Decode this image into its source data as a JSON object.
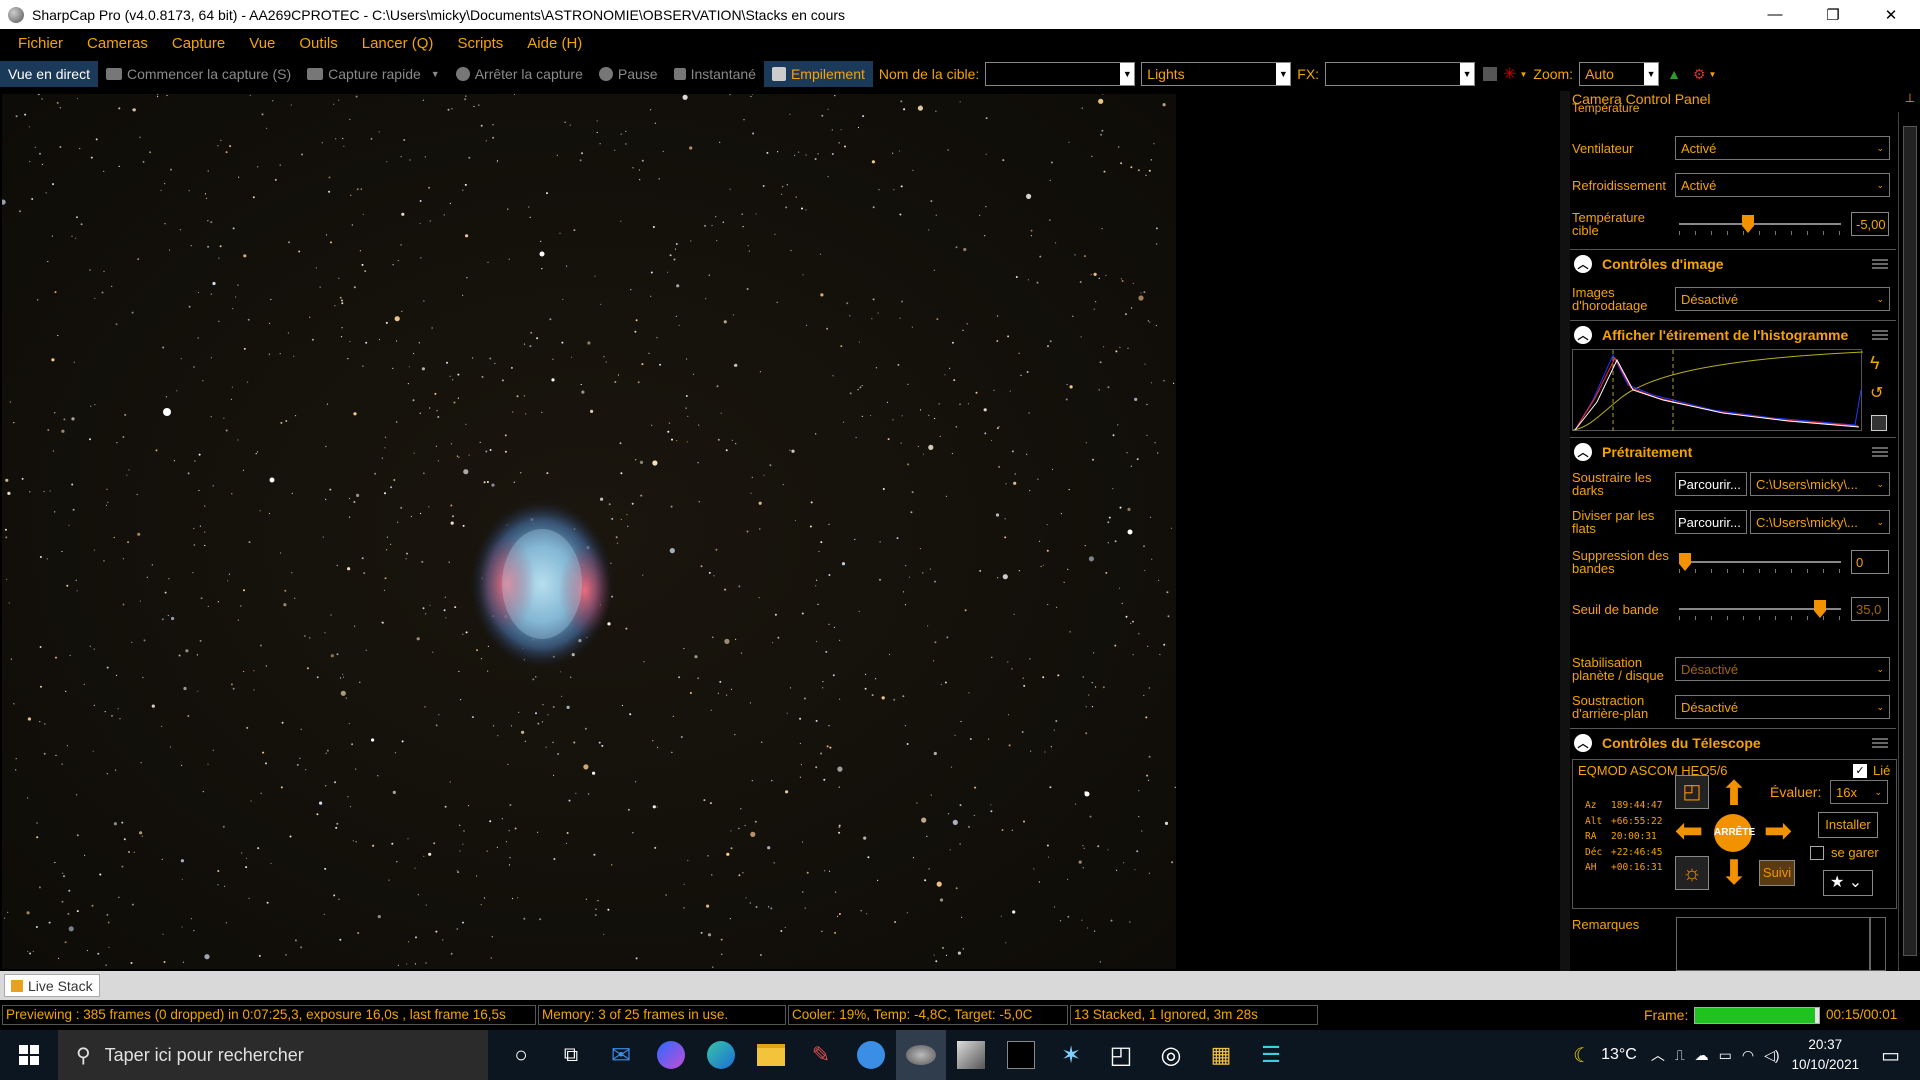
{
  "window": {
    "title": "SharpCap Pro (v4.0.8173, 64 bit) - AA269CPROTEC - C:\\Users\\micky\\Documents\\ASTRONOMIE\\OBSERVATION\\Stacks en cours",
    "minimize": "—",
    "restore": "❐",
    "close": "✕"
  },
  "menu": [
    "Fichier",
    "Cameras",
    "Capture",
    "Vue",
    "Outils",
    "Lancer (Q)",
    "Scripts",
    "Aide (H)"
  ],
  "toolbar": {
    "live_view": "Vue en direct",
    "start_capture": "Commencer la capture (S)",
    "quick_capture": "Capture rapide",
    "stop_capture": "Arrêter la capture",
    "pause": "Pause",
    "snapshot": "Instantané",
    "stacking": "Empilement",
    "target_label": "Nom de la cible:",
    "target_value": "",
    "frame_type": "Lights",
    "fx_label": "FX:",
    "fx_value": "",
    "zoom_label": "Zoom:",
    "zoom_value": "Auto"
  },
  "panel": {
    "header": "Camera Control Panel",
    "temperature_label": "Température",
    "fan_label": "Ventilateur",
    "fan_value": "Activé",
    "cooling_label": "Refroidissement",
    "cooling_value": "Activé",
    "target_temp_label": "Température cible",
    "target_temp_value": "-5,00",
    "target_temp_level": 0.42,
    "sec_image": "Contrôles d'image",
    "timestamp_label": "Images d'horodatage",
    "timestamp_value": "Désactivé",
    "sec_histo": "Afficher l'étirement de l'histogramme",
    "sec_preproc": "Prétraitement",
    "darks_label": "Soustraire les darks",
    "darks_browse": "Parcourir...",
    "darks_path": "C:\\Users\\micky\\...",
    "flats_label": "Diviser par les flats",
    "flats_browse": "Parcourir...",
    "flats_path": "C:\\Users\\micky\\...",
    "banding_label": "Suppression des bandes",
    "banding_value": "0",
    "banding_level": 0.0,
    "band_thresh_label": "Seuil de bande",
    "band_thresh_value": "35,0",
    "band_thresh_level": 0.9,
    "stabilize_label": "Stabilisation planète / disque",
    "stabilize_value": "Désactivé",
    "bg_sub_label": "Soustraction d'arrière-plan",
    "bg_sub_value": "Désactivé",
    "sec_telescope": "Contrôles du Télescope",
    "mount": "EQMOD ASCOM HEQ5/6",
    "linked": "Lié",
    "coords": [
      [
        "Az",
        "189:44:47"
      ],
      [
        "Alt",
        "+66:55:22"
      ],
      [
        "RA",
        "20:00:31"
      ],
      [
        "Déc",
        "+22:46:45"
      ],
      [
        "AH",
        "+00:16:31"
      ]
    ],
    "rate_label": "Évaluer:",
    "rate_value": "16x",
    "stop": "ARRÊTE",
    "install": "Installer",
    "park": "se garer",
    "track": "Suivi",
    "remarks": "Remarques"
  },
  "live_stack_tab": "Live Stack",
  "status": {
    "preview": "Previewing : 385 frames (0 dropped) in 0:07:25,3, exposure 16,0s , last frame 16,5s",
    "memory": "Memory: 3 of 25 frames in use.",
    "cooler": "Cooler: 19%, Temp: -4,8C, Target: -5,0C",
    "stacked": "13 Stacked, 1 Ignored, 3m 28s",
    "frame_label": "Frame:",
    "frame_progress": 0.97,
    "frame_time": "00:15/00:01"
  },
  "taskbar": {
    "search_placeholder": "Taper ici pour rechercher",
    "weather": "13°C",
    "time": "20:37",
    "date": "10/10/2021"
  },
  "colors": {
    "accent": "#f5a300",
    "orange_btn": "#f39200",
    "progress_green": "#1ec31e"
  }
}
